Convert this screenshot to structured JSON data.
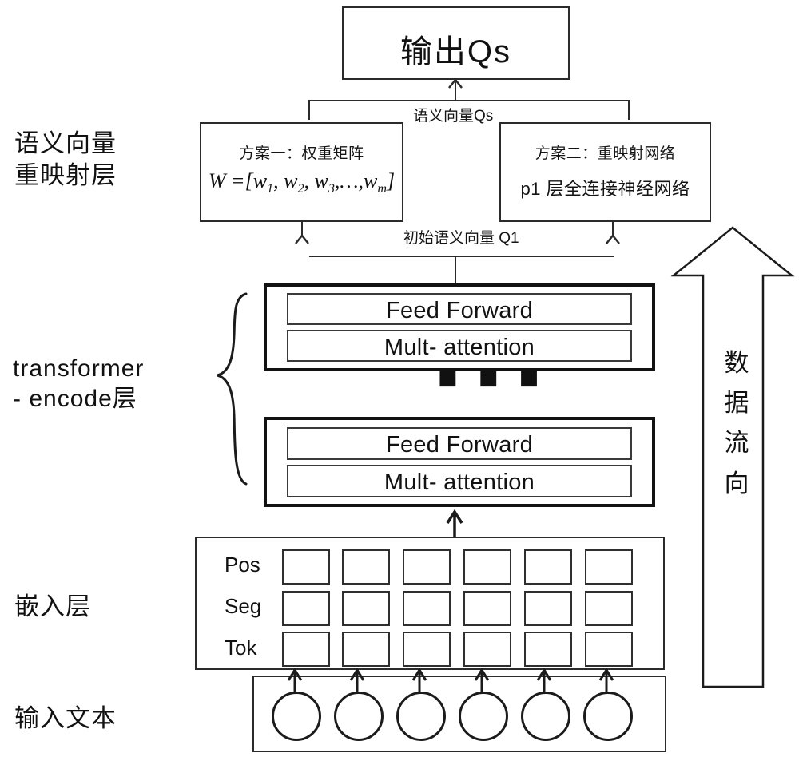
{
  "diagram": {
    "title": "BERT-based semantic vector remapping architecture",
    "stroke_color": "#2b2b2b",
    "background": "#ffffff"
  },
  "left_labels": [
    {
      "id": "semantic-remap",
      "line1": "语义向量",
      "line2": "重映射层"
    },
    {
      "id": "transformer-encoder",
      "line1": "transformer",
      "line2": "- encode层"
    },
    {
      "id": "embedding",
      "line1": "嵌入层",
      "line2": ""
    },
    {
      "id": "input-text",
      "line1": "输入文本",
      "line2": ""
    }
  ],
  "output": {
    "label": "输出Qs"
  },
  "edges": {
    "to_output": "语义向量Qs",
    "to_remap": "初始语义向量 Q1"
  },
  "remap_options": [
    {
      "id": "option-one",
      "title": "方案一：权重矩阵",
      "formula_prefix": "W =[",
      "formula_terms": [
        "w1",
        "w2",
        "w3"
      ],
      "formula_ellipsis": "…,",
      "formula_last": "wm",
      "formula_suffix": "]"
    },
    {
      "id": "option-two",
      "title": "方案二：重映射网络",
      "line2": "p1 层全连接神经网络"
    }
  ],
  "encoder_blocks": [
    {
      "id": "encoder-top",
      "feed_forward": "Feed Forward",
      "attention": "Mult- attention"
    },
    {
      "id": "encoder-bottom",
      "feed_forward": "Feed Forward",
      "attention": "Mult- attention"
    }
  ],
  "encoder_repeat_indicator": "■ ■ ■",
  "embedding": {
    "rows": [
      "Pos",
      "Seg",
      "Tok"
    ],
    "columns": 6
  },
  "input_tokens": {
    "count": 6
  },
  "flow_arrow": {
    "text_chars": [
      "数",
      "据",
      "流",
      "向"
    ],
    "text": "数据流向",
    "direction": "up"
  }
}
